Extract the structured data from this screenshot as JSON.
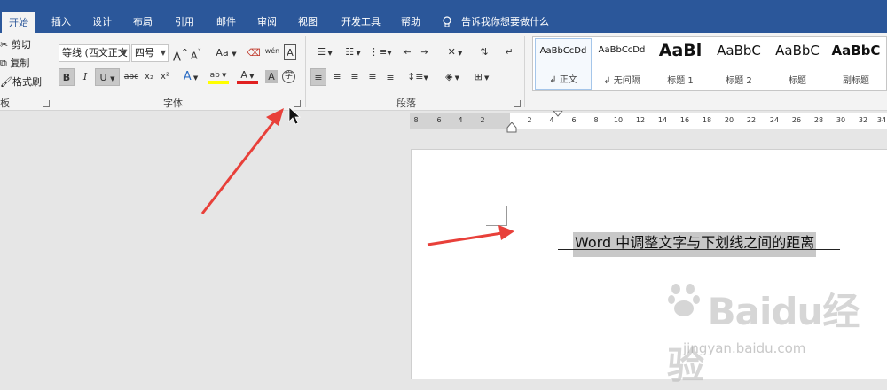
{
  "tabs": [
    {
      "label": "开始",
      "active": true
    },
    {
      "label": "插入"
    },
    {
      "label": "设计"
    },
    {
      "label": "布局"
    },
    {
      "label": "引用"
    },
    {
      "label": "邮件"
    },
    {
      "label": "审阅"
    },
    {
      "label": "视图"
    },
    {
      "label": "开发工具"
    },
    {
      "label": "帮助"
    }
  ],
  "tell_me": "告诉我你想要做什么",
  "clipboard": {
    "cut": "剪切",
    "copy": "复制",
    "format_painter": "格式刷",
    "group_label": "板"
  },
  "font": {
    "font_name": "等线 (西文正文",
    "font_size": "四号",
    "group_label": "字体",
    "grow": "A",
    "shrink": "A",
    "change_case": "Aa",
    "phonetic": "wén",
    "border_char": "A",
    "bold": "B",
    "italic": "I",
    "underline": "U",
    "strike": "abc",
    "subscript": "x₂",
    "superscript": "x²",
    "text_effect": "A",
    "highlight": "ab",
    "font_color": "A",
    "shading": "A",
    "enclose": "字"
  },
  "paragraph": {
    "group_label": "段落"
  },
  "styles": [
    {
      "preview": "AaBbCcDd",
      "name": "↲ 正文"
    },
    {
      "preview": "AaBbCcDd",
      "name": "↲ 无间隔"
    },
    {
      "preview": "AaBl",
      "name": "标题 1"
    },
    {
      "preview": "AaBbC",
      "name": "标题 2"
    },
    {
      "preview": "AaBbC",
      "name": "标题"
    },
    {
      "preview": "AaBbC",
      "name": "副标题"
    }
  ],
  "ruler": {
    "ticks": [
      "8",
      "6",
      "4",
      "2",
      "2",
      "4",
      "6",
      "8",
      "10",
      "12",
      "14",
      "16",
      "18",
      "20",
      "22",
      "24",
      "26",
      "28",
      "30",
      "32",
      "34"
    ]
  },
  "document": {
    "heading": "Word 中调整文字与下划线之间的距离"
  },
  "watermark": {
    "brand": "Baidu经验",
    "url": "jingyan.baidu.com"
  },
  "colors": {
    "ribbon_blue": "#2b579a",
    "arrow_red": "#e8403a",
    "highlight_yellow": "#ffff00",
    "font_red": "#e02020"
  }
}
